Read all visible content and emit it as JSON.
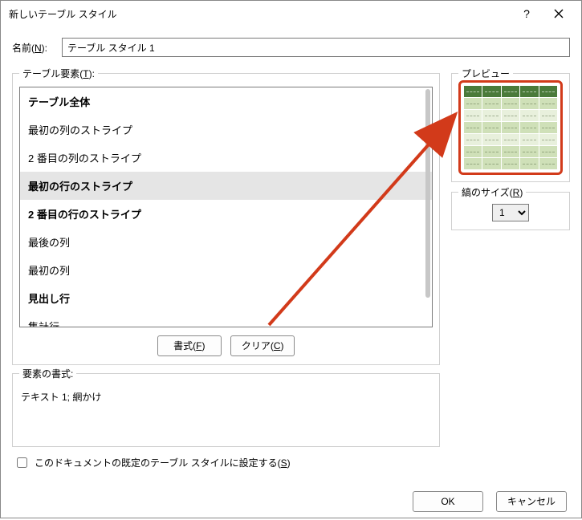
{
  "titlebar": {
    "title": "新しいテーブル スタイル",
    "help": "?",
    "close": "✕"
  },
  "name": {
    "label_pre": "名前(",
    "label_u": "N",
    "label_post": "):",
    "value": "テーブル スタイル 1"
  },
  "elements": {
    "legend_pre": "テーブル要素(",
    "legend_u": "T",
    "legend_post": "):",
    "items": [
      {
        "label": "テーブル全体",
        "bold": true,
        "selected": false
      },
      {
        "label": "最初の列のストライプ",
        "bold": false,
        "selected": false
      },
      {
        "label": "2 番目の列のストライプ",
        "bold": false,
        "selected": false
      },
      {
        "label": "最初の行のストライプ",
        "bold": true,
        "selected": true
      },
      {
        "label": "2 番目の行のストライプ",
        "bold": true,
        "selected": false
      },
      {
        "label": "最後の列",
        "bold": false,
        "selected": false
      },
      {
        "label": "最初の列",
        "bold": false,
        "selected": false
      },
      {
        "label": "見出し行",
        "bold": true,
        "selected": false
      },
      {
        "label": "集計行",
        "bold": false,
        "selected": false
      }
    ],
    "format_btn_pre": "書式(",
    "format_btn_u": "F",
    "format_btn_post": ")",
    "clear_btn_pre": "クリア(",
    "clear_btn_u": "C",
    "clear_btn_post": ")"
  },
  "format": {
    "legend": "要素の書式:",
    "text": "テキスト 1; 網かけ"
  },
  "preview": {
    "legend": "プレビュー"
  },
  "stripe": {
    "legend_pre": "縞のサイズ(",
    "legend_u": "R",
    "legend_post": ")",
    "value": "1"
  },
  "default_check": {
    "label_pre": "このドキュメントの既定のテーブル スタイルに設定する(",
    "label_u": "S",
    "label_post": ")"
  },
  "footer": {
    "ok": "OK",
    "cancel": "キャンセル"
  }
}
